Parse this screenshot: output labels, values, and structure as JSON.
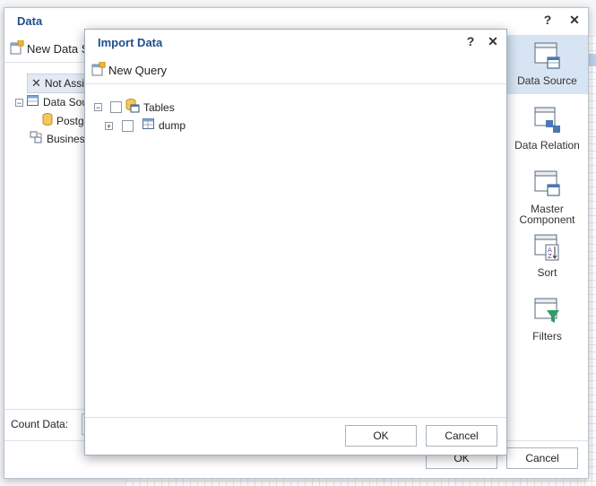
{
  "data_dialog": {
    "title": "Data",
    "help_label": "?",
    "close_label": "✕",
    "new_data_source_label": "New Data So",
    "tree": {
      "not_assigned_label": "Not Assig",
      "data_source_label": "Data Sou",
      "postgres_label": "Postgr",
      "business_label": "Business"
    },
    "count_data_label": "Count Data:",
    "right_panel": [
      {
        "label": "Data Source",
        "icon": "data-source-icon"
      },
      {
        "label": "Data Relation",
        "icon": "data-relation-icon"
      },
      {
        "label": "Master Component",
        "icon": "master-component-icon"
      },
      {
        "label": "Sort",
        "icon": "sort-icon"
      },
      {
        "label": "Filters",
        "icon": "filters-icon"
      }
    ],
    "ok_label": "OK",
    "cancel_label": "Cancel"
  },
  "import_dialog": {
    "title": "Import Data",
    "help_label": "?",
    "close_label": "✕",
    "new_query_label": "New Query",
    "tree": {
      "tables_label": "Tables",
      "dump_label": "dump"
    },
    "ok_label": "OK",
    "cancel_label": "Cancel"
  },
  "colors": {
    "title": "#1f4e8c",
    "active_item": "#d6e4f3",
    "border": "#b9c2cc"
  }
}
